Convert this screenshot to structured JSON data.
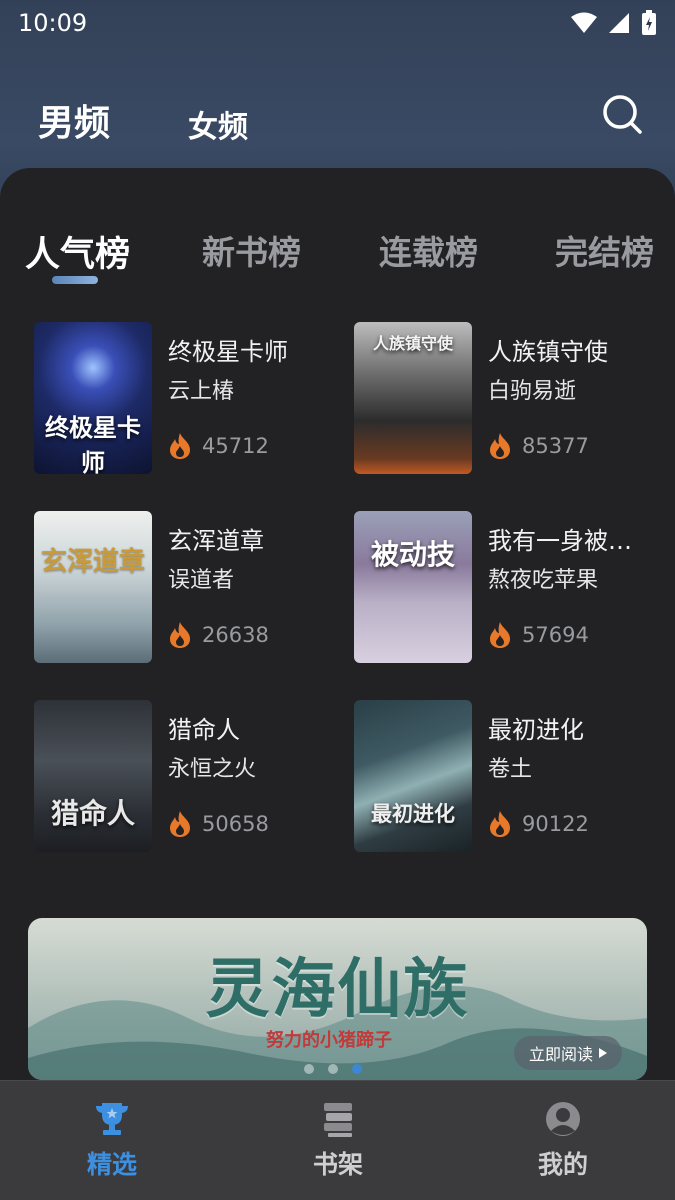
{
  "status_bar": {
    "time": "10:09"
  },
  "header": {
    "tabs": [
      {
        "label": "男频",
        "active": true
      },
      {
        "label": "女频",
        "active": false
      }
    ]
  },
  "rank_tabs": [
    {
      "label": "人气榜",
      "active": true
    },
    {
      "label": "新书榜",
      "active": false
    },
    {
      "label": "连载榜",
      "active": false
    },
    {
      "label": "完结榜",
      "active": false
    }
  ],
  "books": [
    {
      "title": "终极星卡师",
      "author": "云上椿",
      "heat": "45712",
      "cover_text": "终极星卡师",
      "cover_color": "#1d2a66"
    },
    {
      "title": "人族镇守使",
      "author": "白驹易逝",
      "heat": "85377",
      "cover_text": "人族镇守使",
      "cover_color": "#3a3a3a"
    },
    {
      "title": "玄浑道章",
      "author": "误道者",
      "heat": "26638",
      "cover_text": "玄浑道章",
      "cover_color": "#b9c4c8"
    },
    {
      "title": "我有一身被…",
      "author": "熬夜吃苹果",
      "heat": "57694",
      "cover_text": "被动技",
      "cover_color": "#8a7a9c"
    },
    {
      "title": "猎命人",
      "author": "永恒之火",
      "heat": "50658",
      "cover_text": "猎命人",
      "cover_color": "#3b4048"
    },
    {
      "title": "最初进化",
      "author": "卷土",
      "heat": "90122",
      "cover_text": "最初进化",
      "cover_color": "#3f5a63"
    }
  ],
  "banner": {
    "title": "灵海仙族",
    "author": "努力的小猪蹄子",
    "button": "立即阅读",
    "slides": 3,
    "active_slide": 3
  },
  "bottom_nav": [
    {
      "label": "精选",
      "icon": "trophy-icon",
      "active": true
    },
    {
      "label": "书架",
      "icon": "bookshelf-icon",
      "active": false
    },
    {
      "label": "我的",
      "icon": "profile-icon",
      "active": false
    }
  ],
  "colors": {
    "accent": "#3d8fe0",
    "panel": "#222225",
    "heat": "#e8792a"
  }
}
